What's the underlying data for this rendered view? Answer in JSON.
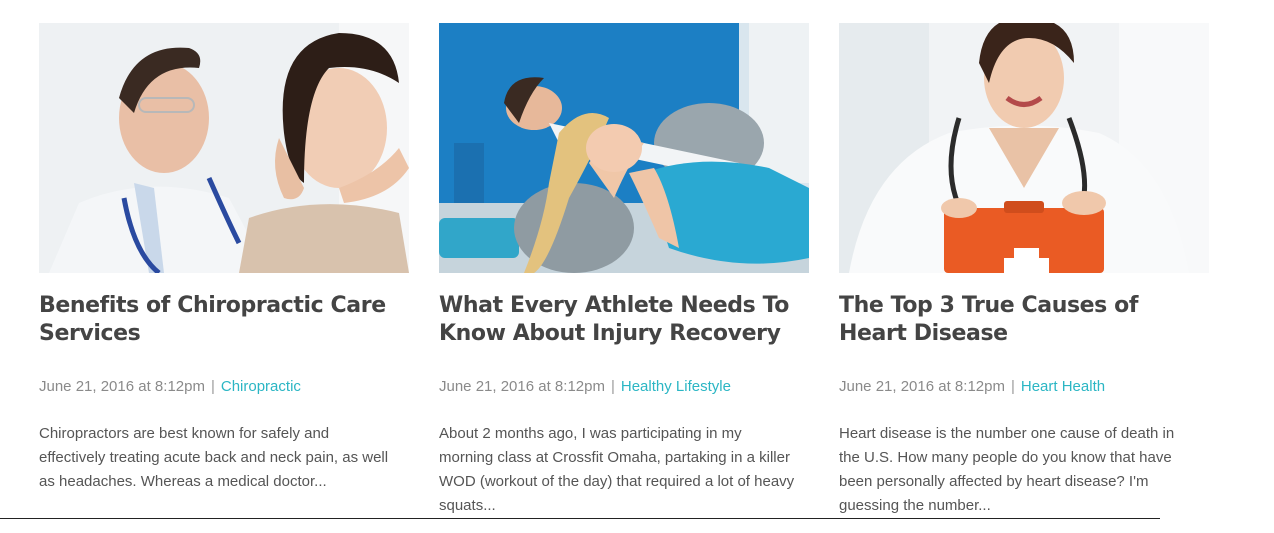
{
  "posts": [
    {
      "image": "chiropractor-adjusting-patient-neck-photo",
      "title": "Benefits of Chiropractic Care Services",
      "date": "June 21, 2016 at 8:12pm",
      "separator": "|",
      "category": "Chiropractic",
      "excerpt": "Chiropractors are best known for safely and effectively treating acute back and neck pain, as well as headaches. Whereas a medical doctor..."
    },
    {
      "image": "athletes-doing-situps-on-exercise-ball-photo",
      "title": "What Every Athlete Needs To Know About Injury Recovery",
      "date": "June 21, 2016 at 8:12pm",
      "separator": "|",
      "category": "Healthy Lifestyle",
      "excerpt": "About 2 months ago, I was participating in my morning class at Crossfit Omaha, partaking in a killer WOD (workout of the day) that required a lot of heavy squats..."
    },
    {
      "image": "doctor-holding-first-aid-kit-photo",
      "title": "The Top 3 True Causes of Heart Disease",
      "date": "June 21, 2016 at 8:12pm",
      "separator": "|",
      "category": "Heart Health",
      "excerpt": "Heart disease is the number one cause of death in the U.S. How many people do you know that have been personally affected by heart disease? I'm guessing the number..."
    }
  ],
  "colors": {
    "title": "#444444",
    "meta": "#8a8a8a",
    "category_link": "#2bb6c4",
    "excerpt": "#555555"
  }
}
